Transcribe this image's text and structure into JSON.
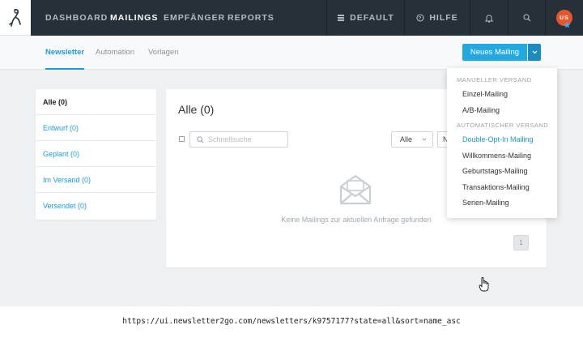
{
  "nav": {
    "items": [
      {
        "label": "DASHBOARD",
        "active": false
      },
      {
        "label": "MAILINGS",
        "active": true
      },
      {
        "label": "EMPFÄNGER",
        "active": false
      },
      {
        "label": "REPORTS",
        "active": false
      }
    ],
    "account_label": "DEFAULT",
    "help_label": "HILFE",
    "avatar_initials": "US"
  },
  "subnav": {
    "tabs": [
      {
        "label": "Newsletter",
        "active": true
      },
      {
        "label": "Automation",
        "active": false
      },
      {
        "label": "Vorlagen",
        "active": false
      }
    ],
    "new_button_label": "Neues Mailing"
  },
  "sidebar": {
    "items": [
      {
        "label": "Alle (0)",
        "active": true
      },
      {
        "label": "Entwurf (0)",
        "active": false
      },
      {
        "label": "Geplant (0)",
        "active": false
      },
      {
        "label": "Im Versand (0)",
        "active": false
      },
      {
        "label": "Versendet (0)",
        "active": false
      }
    ]
  },
  "content": {
    "title": "Alle (0)",
    "search_placeholder": "Schnellsuche",
    "filter_value": "Alle",
    "filter2_value": "N",
    "empty_message": "Keine Mailings zur aktuellen Anfrage gefunden",
    "page_number": "1"
  },
  "dropdown": {
    "section_manual": "MANUELLER VERSAND",
    "manual_items": [
      "Einzel-Mailing",
      "A/B-Mailing"
    ],
    "section_auto": "AUTOMATISCHER VERSAND",
    "auto_items": [
      "Double-Opt-In Mailing",
      "Willkommens-Mailing",
      "Geburtstags-Mailing",
      "Transaktions-Mailing",
      "Serien-Mailing"
    ]
  },
  "url": "https://ui.newsletter2go.com/newsletters/k9757177?state=all&sort=name_asc",
  "colors": {
    "nav_bg": "#263038",
    "accent": "#23a9e1",
    "link": "#1b9dd6",
    "avatar": "#e8572c"
  }
}
